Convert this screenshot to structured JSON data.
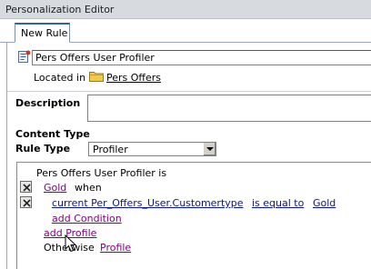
{
  "window": {
    "title": "Personalization Editor"
  },
  "tabs": [
    {
      "label": "New Rule"
    }
  ],
  "rule": {
    "name_value": "Pers Offers User Profiler",
    "located_label": "Located in",
    "location": "Pers Offers"
  },
  "form": {
    "description_label": "Description",
    "description_value": "",
    "content_type_label": "Content Type",
    "rule_type_label": "Rule Type",
    "rule_type_value": "Profiler"
  },
  "tree": {
    "header": "Pers Offers User Profiler is",
    "profile_name": "Gold",
    "when": "when",
    "condition": {
      "field": "current Per_Offers_User.Customertype",
      "operator": "is equal to",
      "value": "Gold"
    },
    "add_condition": "add Condition",
    "add_profile": "add Profile",
    "otherwise_label": "Otherwise",
    "otherwise_value": "Profile"
  }
}
